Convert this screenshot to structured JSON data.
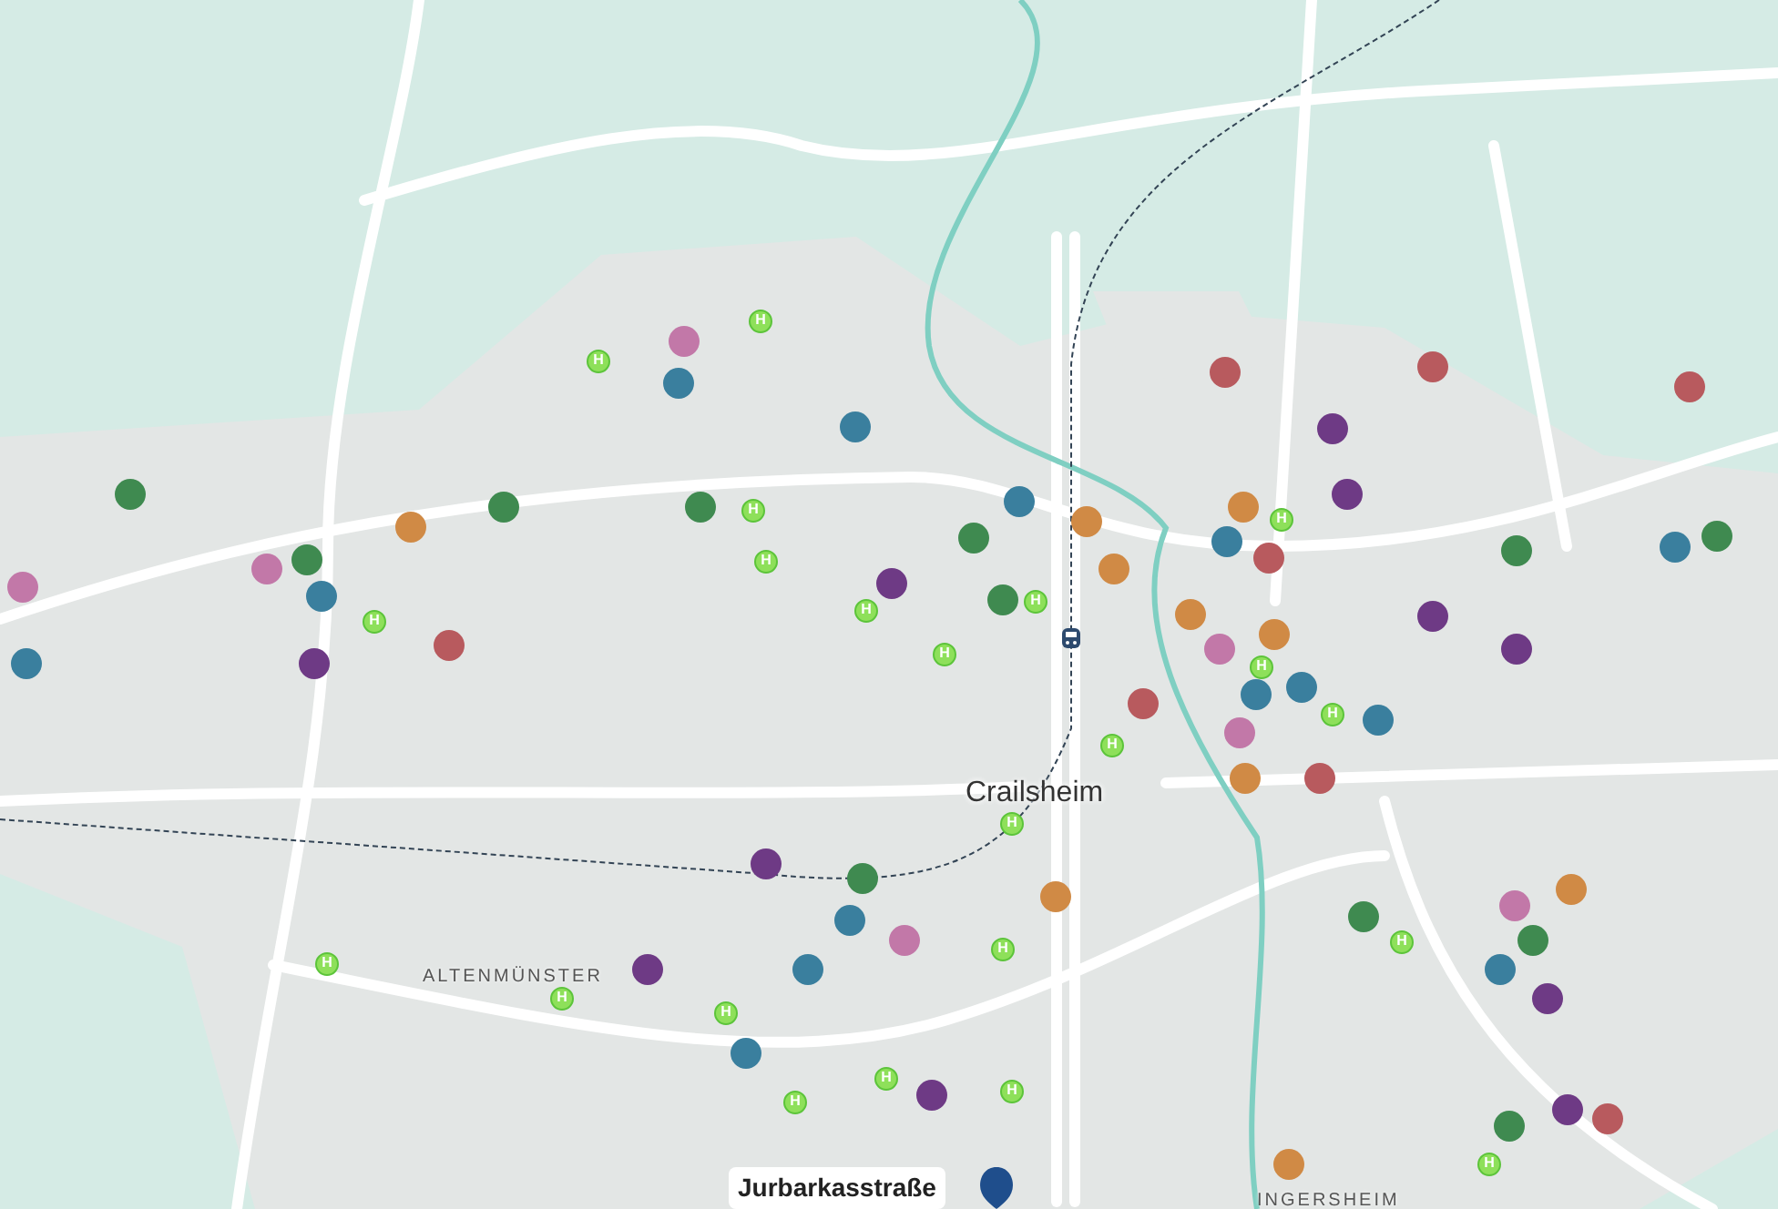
{
  "places": [
    {
      "label": "Crailsheim",
      "kind": "city"
    },
    {
      "label": "ALTENMÜNSTER",
      "kind": "district"
    },
    {
      "label": "INGERSHEIM",
      "kind": "district"
    }
  ],
  "selected_location": {
    "label": "Jurbarkasstraße"
  },
  "pins": [
    {
      "color": "#3f8a50"
    },
    {
      "color": "#c278a8"
    },
    {
      "color": "#3a7f9e"
    },
    {
      "color": "#c278a8"
    },
    {
      "color": "#3f8a50"
    },
    {
      "color": "#3a7f9e"
    },
    {
      "color": "#6e3a85"
    },
    {
      "color": "#d08a45"
    },
    {
      "color": "#b85a5e"
    },
    {
      "color": "#3f8a50"
    },
    {
      "color": "#c278a8"
    },
    {
      "color": "#3a7f9e"
    },
    {
      "color": "#3f8a50"
    },
    {
      "color": "#3a7f9e"
    },
    {
      "color": "#6e3a85"
    },
    {
      "color": "#3f8a50"
    },
    {
      "color": "#3f8a50"
    },
    {
      "color": "#3a7f9e"
    },
    {
      "color": "#d08a45"
    },
    {
      "color": "#d08a45"
    },
    {
      "color": "#b85a5e"
    },
    {
      "color": "#6e3a85"
    },
    {
      "color": "#d08a45"
    },
    {
      "color": "#3a7f9e"
    },
    {
      "color": "#b85a5e"
    },
    {
      "color": "#6e3a85"
    },
    {
      "color": "#d08a45"
    },
    {
      "color": "#c278a8"
    },
    {
      "color": "#d08a45"
    },
    {
      "color": "#b85a5e"
    },
    {
      "color": "#3a7f9e"
    },
    {
      "color": "#3a7f9e"
    },
    {
      "color": "#3a7f9e"
    },
    {
      "color": "#c278a8"
    },
    {
      "color": "#d08a45"
    },
    {
      "color": "#b85a5e"
    },
    {
      "color": "#b85a5e"
    },
    {
      "color": "#b85a5e"
    },
    {
      "color": "#3f8a50"
    },
    {
      "color": "#3a7f9e"
    },
    {
      "color": "#3f8a50"
    },
    {
      "color": "#6e3a85"
    },
    {
      "color": "#6e3a85"
    },
    {
      "color": "#6e3a85"
    },
    {
      "color": "#3f8a50"
    },
    {
      "color": "#3a7f9e"
    },
    {
      "color": "#c278a8"
    },
    {
      "color": "#d08a45"
    },
    {
      "color": "#6e3a85"
    },
    {
      "color": "#3a7f9e"
    },
    {
      "color": "#3a7f9e"
    },
    {
      "color": "#6e3a85"
    },
    {
      "color": "#3f8a50"
    },
    {
      "color": "#c278a8"
    },
    {
      "color": "#d08a45"
    },
    {
      "color": "#3f8a50"
    },
    {
      "color": "#3a7f9e"
    },
    {
      "color": "#6e3a85"
    },
    {
      "color": "#3f8a50"
    },
    {
      "color": "#6e3a85"
    },
    {
      "color": "#b85a5e"
    },
    {
      "color": "#d08a45"
    }
  ],
  "bus_stops": [
    {
      "label": "H"
    },
    {
      "label": "H"
    },
    {
      "label": "H"
    },
    {
      "label": "H"
    },
    {
      "label": "H"
    },
    {
      "label": "H"
    },
    {
      "label": "H"
    },
    {
      "label": "H"
    },
    {
      "label": "H"
    },
    {
      "label": "H"
    },
    {
      "label": "H"
    },
    {
      "label": "H"
    },
    {
      "label": "H"
    },
    {
      "label": "H"
    },
    {
      "label": "H"
    },
    {
      "label": "H"
    },
    {
      "label": "H"
    },
    {
      "label": "H"
    },
    {
      "label": "H"
    },
    {
      "label": "H"
    },
    {
      "label": "H"
    },
    {
      "label": "H"
    }
  ]
}
